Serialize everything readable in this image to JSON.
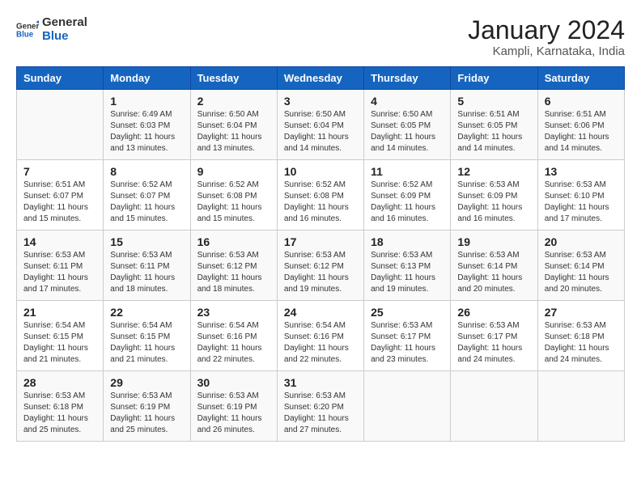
{
  "logo": {
    "line1": "General",
    "line2": "Blue"
  },
  "title": "January 2024",
  "location": "Kampli, Karnataka, India",
  "headers": [
    "Sunday",
    "Monday",
    "Tuesday",
    "Wednesday",
    "Thursday",
    "Friday",
    "Saturday"
  ],
  "weeks": [
    [
      {
        "day": "",
        "info": ""
      },
      {
        "day": "1",
        "info": "Sunrise: 6:49 AM\nSunset: 6:03 PM\nDaylight: 11 hours\nand 13 minutes."
      },
      {
        "day": "2",
        "info": "Sunrise: 6:50 AM\nSunset: 6:04 PM\nDaylight: 11 hours\nand 13 minutes."
      },
      {
        "day": "3",
        "info": "Sunrise: 6:50 AM\nSunset: 6:04 PM\nDaylight: 11 hours\nand 14 minutes."
      },
      {
        "day": "4",
        "info": "Sunrise: 6:50 AM\nSunset: 6:05 PM\nDaylight: 11 hours\nand 14 minutes."
      },
      {
        "day": "5",
        "info": "Sunrise: 6:51 AM\nSunset: 6:05 PM\nDaylight: 11 hours\nand 14 minutes."
      },
      {
        "day": "6",
        "info": "Sunrise: 6:51 AM\nSunset: 6:06 PM\nDaylight: 11 hours\nand 14 minutes."
      }
    ],
    [
      {
        "day": "7",
        "info": "Sunrise: 6:51 AM\nSunset: 6:07 PM\nDaylight: 11 hours\nand 15 minutes."
      },
      {
        "day": "8",
        "info": "Sunrise: 6:52 AM\nSunset: 6:07 PM\nDaylight: 11 hours\nand 15 minutes."
      },
      {
        "day": "9",
        "info": "Sunrise: 6:52 AM\nSunset: 6:08 PM\nDaylight: 11 hours\nand 15 minutes."
      },
      {
        "day": "10",
        "info": "Sunrise: 6:52 AM\nSunset: 6:08 PM\nDaylight: 11 hours\nand 16 minutes."
      },
      {
        "day": "11",
        "info": "Sunrise: 6:52 AM\nSunset: 6:09 PM\nDaylight: 11 hours\nand 16 minutes."
      },
      {
        "day": "12",
        "info": "Sunrise: 6:53 AM\nSunset: 6:09 PM\nDaylight: 11 hours\nand 16 minutes."
      },
      {
        "day": "13",
        "info": "Sunrise: 6:53 AM\nSunset: 6:10 PM\nDaylight: 11 hours\nand 17 minutes."
      }
    ],
    [
      {
        "day": "14",
        "info": "Sunrise: 6:53 AM\nSunset: 6:11 PM\nDaylight: 11 hours\nand 17 minutes."
      },
      {
        "day": "15",
        "info": "Sunrise: 6:53 AM\nSunset: 6:11 PM\nDaylight: 11 hours\nand 18 minutes."
      },
      {
        "day": "16",
        "info": "Sunrise: 6:53 AM\nSunset: 6:12 PM\nDaylight: 11 hours\nand 18 minutes."
      },
      {
        "day": "17",
        "info": "Sunrise: 6:53 AM\nSunset: 6:12 PM\nDaylight: 11 hours\nand 19 minutes."
      },
      {
        "day": "18",
        "info": "Sunrise: 6:53 AM\nSunset: 6:13 PM\nDaylight: 11 hours\nand 19 minutes."
      },
      {
        "day": "19",
        "info": "Sunrise: 6:53 AM\nSunset: 6:14 PM\nDaylight: 11 hours\nand 20 minutes."
      },
      {
        "day": "20",
        "info": "Sunrise: 6:53 AM\nSunset: 6:14 PM\nDaylight: 11 hours\nand 20 minutes."
      }
    ],
    [
      {
        "day": "21",
        "info": "Sunrise: 6:54 AM\nSunset: 6:15 PM\nDaylight: 11 hours\nand 21 minutes."
      },
      {
        "day": "22",
        "info": "Sunrise: 6:54 AM\nSunset: 6:15 PM\nDaylight: 11 hours\nand 21 minutes."
      },
      {
        "day": "23",
        "info": "Sunrise: 6:54 AM\nSunset: 6:16 PM\nDaylight: 11 hours\nand 22 minutes."
      },
      {
        "day": "24",
        "info": "Sunrise: 6:54 AM\nSunset: 6:16 PM\nDaylight: 11 hours\nand 22 minutes."
      },
      {
        "day": "25",
        "info": "Sunrise: 6:53 AM\nSunset: 6:17 PM\nDaylight: 11 hours\nand 23 minutes."
      },
      {
        "day": "26",
        "info": "Sunrise: 6:53 AM\nSunset: 6:17 PM\nDaylight: 11 hours\nand 24 minutes."
      },
      {
        "day": "27",
        "info": "Sunrise: 6:53 AM\nSunset: 6:18 PM\nDaylight: 11 hours\nand 24 minutes."
      }
    ],
    [
      {
        "day": "28",
        "info": "Sunrise: 6:53 AM\nSunset: 6:18 PM\nDaylight: 11 hours\nand 25 minutes."
      },
      {
        "day": "29",
        "info": "Sunrise: 6:53 AM\nSunset: 6:19 PM\nDaylight: 11 hours\nand 25 minutes."
      },
      {
        "day": "30",
        "info": "Sunrise: 6:53 AM\nSunset: 6:19 PM\nDaylight: 11 hours\nand 26 minutes."
      },
      {
        "day": "31",
        "info": "Sunrise: 6:53 AM\nSunset: 6:20 PM\nDaylight: 11 hours\nand 27 minutes."
      },
      {
        "day": "",
        "info": ""
      },
      {
        "day": "",
        "info": ""
      },
      {
        "day": "",
        "info": ""
      }
    ]
  ]
}
